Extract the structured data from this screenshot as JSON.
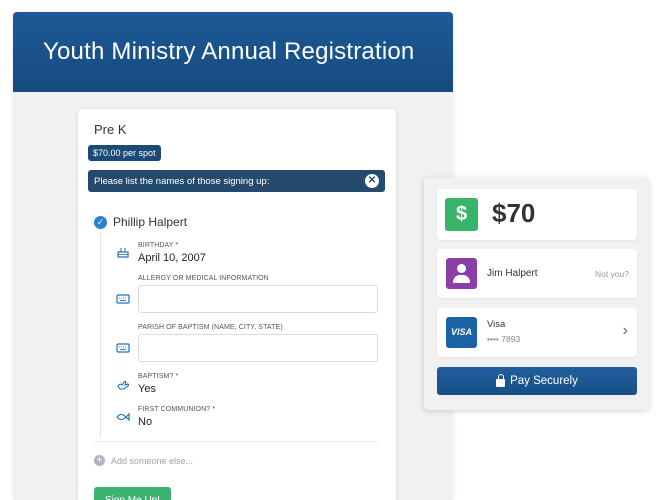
{
  "header": {
    "title": "Youth Ministry Annual Registration"
  },
  "event": {
    "name": "Pre K",
    "price": "$70.00 per spot",
    "instructions": "Please list the names of those signing up:"
  },
  "registrant": {
    "name": "Phillip Halpert",
    "fields": {
      "birthday": {
        "label": "BIRTHDAY *",
        "value": "April 10, 2007"
      },
      "allergy": {
        "label": "ALLERGY OR MEDICAL INFORMATION",
        "value": ""
      },
      "parish": {
        "label": "PARISH OF BAPTISM (NAME, CITY, STATE)",
        "value": ""
      },
      "baptism": {
        "label": "BAPTISM? *",
        "value": "Yes"
      },
      "communion": {
        "label": "FIRST COMMUNION? *",
        "value": "No"
      }
    }
  },
  "add_someone": "Add someone else...",
  "signup_button": "Sign Me Up!",
  "payment": {
    "amount": "$70",
    "dollar_glyph": "$",
    "user_name": "Jim Halpert",
    "not_you": "Not you?",
    "card_logo": "VISA",
    "card_brand": "Visa",
    "card_number": "•••• 7893",
    "pay_button": "Pay Securely"
  },
  "colors": {
    "header_blue": "#1d5a96",
    "instruction_bar": "#244b6d",
    "success_green": "#3cb371",
    "user_purple": "#8a3fa6",
    "visa_blue": "#1a63a7"
  },
  "icons": {
    "birthday": "cake-icon",
    "allergy": "keyboard-icon",
    "parish": "keyboard-icon",
    "baptism": "hand-icon",
    "communion": "fish-icon"
  }
}
